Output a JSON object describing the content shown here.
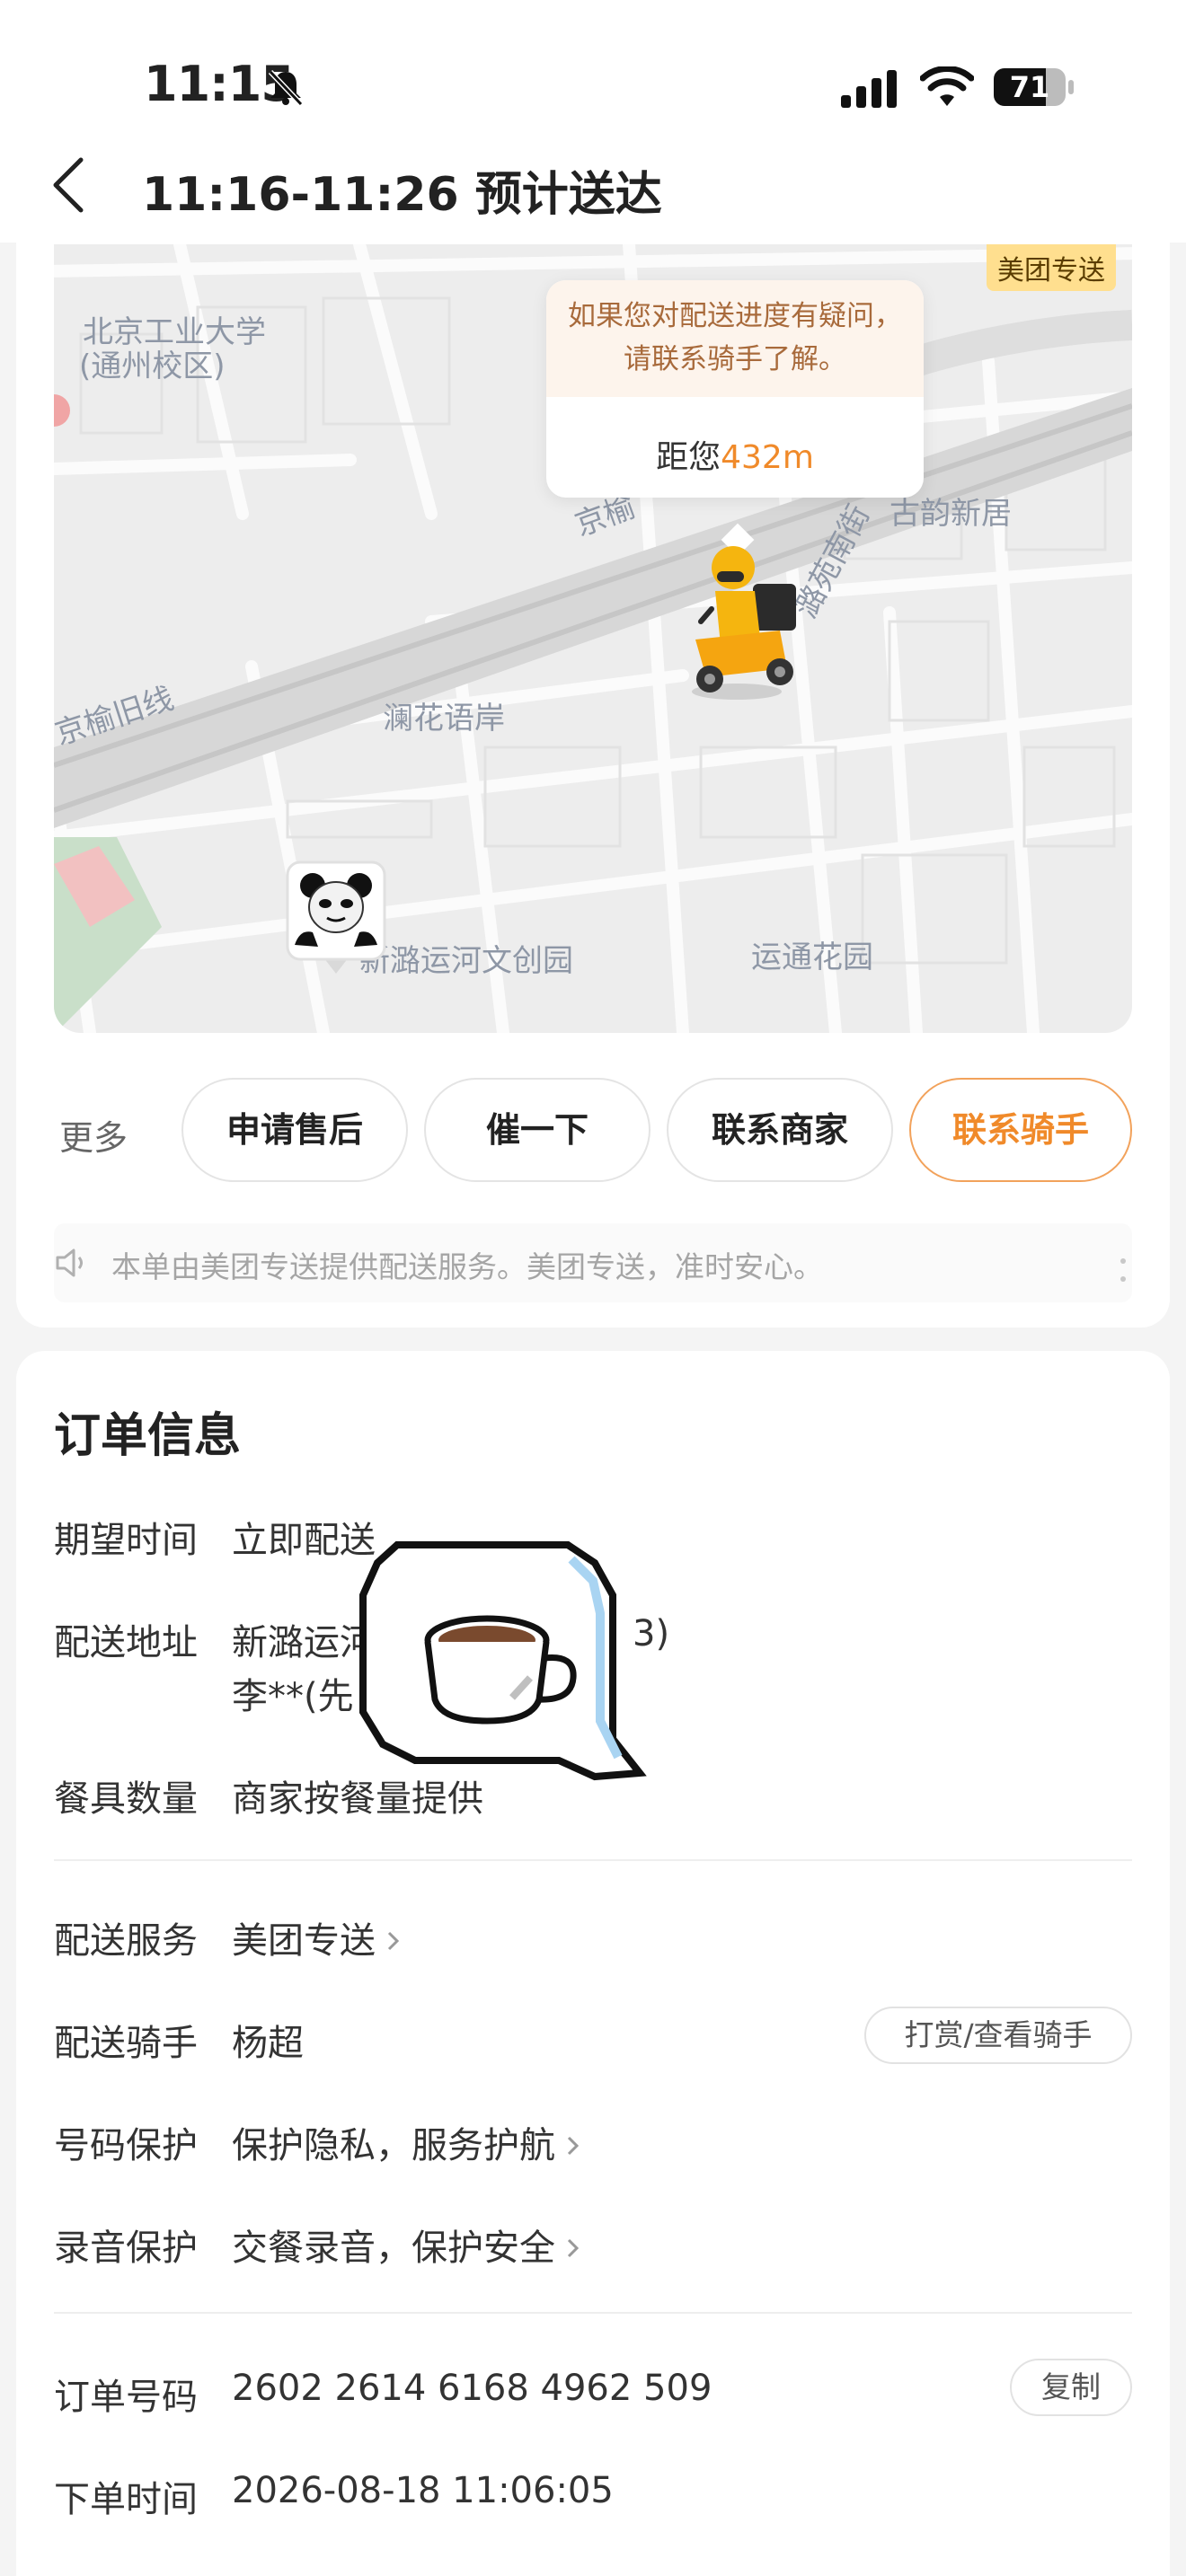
{
  "status_bar": {
    "time": "11:15",
    "battery": "71"
  },
  "header": {
    "title": "11:16-11:26 预计送达"
  },
  "map": {
    "brand_tag": "美团专送",
    "labels": [
      "北京工业大学",
      "(通州校区)",
      "古韵新居",
      "京榆旧线",
      "澜花语岸",
      "新潞运河文创园",
      "运通花园",
      "京榆",
      "潞苑南街"
    ],
    "bubble": {
      "message": "如果您对配送进度有疑问，请联系骑手了解。",
      "distance_prefix": "距您",
      "distance_value": "432m"
    }
  },
  "actions": {
    "more_label": "更多",
    "buttons": [
      "申请售后",
      "催一下",
      "联系商家",
      "联系骑手"
    ]
  },
  "notice": {
    "text": "本单由美团专送提供配送服务。美团专送，准时安心。"
  },
  "order": {
    "title": "订单信息",
    "expected_time": {
      "label": "期望时间",
      "value": "立即配送"
    },
    "address": {
      "label": "配送地址",
      "value_line1": "新潞运河",
      "value_line1_tail": "3)",
      "value_line2": "李**(先"
    },
    "utensils": {
      "label": "餐具数量",
      "value": "商家按餐量提供"
    },
    "service": {
      "label": "配送服务",
      "value": "美团专送"
    },
    "rider": {
      "label": "配送骑手",
      "value": "杨超",
      "action": "打赏/查看骑手"
    },
    "privacy": {
      "label": "号码保护",
      "value": "保护隐私，服务护航"
    },
    "recording": {
      "label": "录音保护",
      "value": "交餐录音，保护安全"
    },
    "order_no": {
      "label": "订单号码",
      "value": "2602 2614 6168 4962 509",
      "action": "复制"
    },
    "order_time": {
      "label": "下单时间",
      "value": "2026-08-18 11:06:05"
    }
  },
  "colors": {
    "accent": "#f08a2a",
    "bubble_bg": "#fdf4ec",
    "brand_tag_bg": "#ffdf8f"
  }
}
